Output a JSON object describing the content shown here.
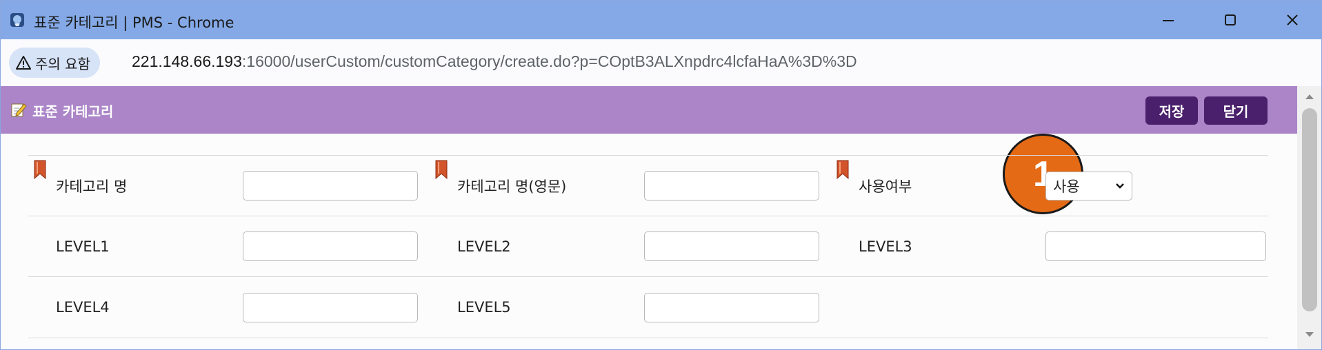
{
  "window": {
    "title": "표준 카테고리 | PMS - Chrome",
    "minimize_icon": "minimize-icon",
    "maximize_icon": "maximize-icon",
    "close_icon": "close-icon"
  },
  "address_bar": {
    "security_label": "주의 요함",
    "url_host": "221.148.66.193",
    "url_rest": ":16000/userCustom/customCategory/create.do?p=COptB3ALXnpdrc4lcfaHaA%3D%3D"
  },
  "header": {
    "title": "표준 카테고리",
    "save_label": "저장",
    "close_label": "닫기",
    "bg_color": "#ab85c8",
    "button_color": "#4a1f6b"
  },
  "badge": {
    "label": "1",
    "color": "#e56a15"
  },
  "form": {
    "rows": [
      [
        {
          "label": "카테고리 명",
          "required": true,
          "control": "input",
          "value": ""
        },
        {
          "label": "카테고리 명(영문)",
          "required": true,
          "control": "input",
          "value": ""
        },
        {
          "label": "사용여부",
          "required": true,
          "control": "select",
          "value": "사용"
        }
      ],
      [
        {
          "label": "LEVEL1",
          "required": false,
          "control": "input",
          "value": ""
        },
        {
          "label": "LEVEL2",
          "required": false,
          "control": "input",
          "value": ""
        },
        {
          "label": "LEVEL3",
          "required": false,
          "control": "input",
          "value": ""
        }
      ],
      [
        {
          "label": "LEVEL4",
          "required": false,
          "control": "input",
          "value": ""
        },
        {
          "label": "LEVEL5",
          "required": false,
          "control": "input",
          "value": ""
        }
      ]
    ]
  }
}
